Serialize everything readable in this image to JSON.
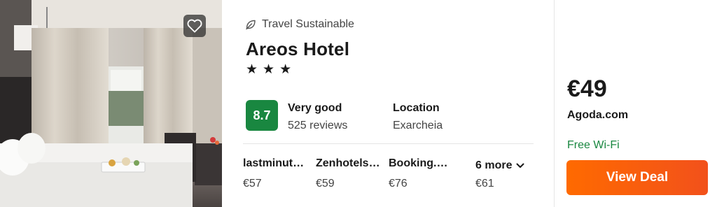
{
  "badge": {
    "label": "Travel Sustainable",
    "icon": "leaf-icon"
  },
  "hotel": {
    "name": "Areos Hotel",
    "stars": 3
  },
  "rating": {
    "score": "8.7",
    "label": "Very good",
    "reviews": "525 reviews",
    "color": "#198740"
  },
  "location": {
    "label": "Location",
    "value": "Exarcheia"
  },
  "providers": [
    {
      "name": "lastminut…",
      "price": "€57"
    },
    {
      "name": "Zenhotels…",
      "price": "€59"
    },
    {
      "name": "Booking.c…",
      "price": "€76"
    }
  ],
  "more": {
    "label": "6 more",
    "price": "€61",
    "icon": "chevron-down-icon"
  },
  "deal": {
    "price": "€49",
    "site": "Agoda.com",
    "amenity": "Free Wi-Fi",
    "button_label": "View Deal",
    "button_color": "#ff6a00"
  },
  "favorite": {
    "icon": "heart-icon"
  }
}
